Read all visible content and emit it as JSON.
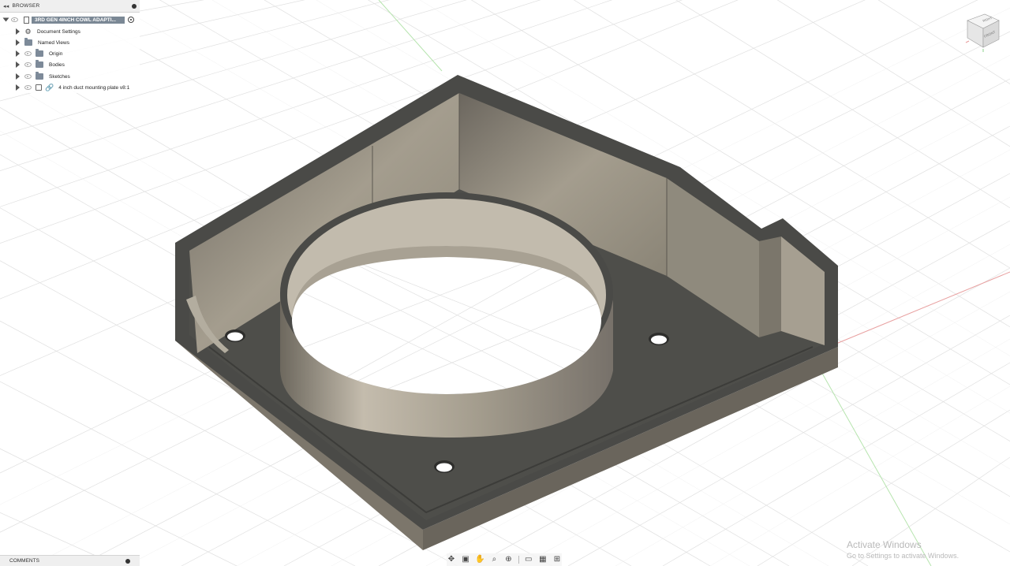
{
  "browser": {
    "title": "BROWSER",
    "root": "3RD GEN 4INCH COWL ADAPTI...",
    "items": [
      {
        "label": "Document Settings",
        "icon": "gear-icon"
      },
      {
        "label": "Named Views",
        "icon": "folder-icon"
      },
      {
        "label": "Origin",
        "icon": "folder-icon"
      },
      {
        "label": "Bodies",
        "icon": "folder-icon"
      },
      {
        "label": "Sketches",
        "icon": "folder-icon"
      },
      {
        "label": "4 inch duct mounting plate v8:1",
        "icon": "link-icon"
      }
    ]
  },
  "comments": {
    "title": "COMMENTS"
  },
  "viewcube": {
    "top": "FRONT",
    "right": "RIGHT"
  },
  "navbar": {
    "icons": [
      "orbit-icon",
      "look-at-icon",
      "pan-icon",
      "zoom-icon",
      "fit-icon",
      "display-settings-icon",
      "grid-icon",
      "viewports-icon"
    ]
  },
  "watermark": {
    "line1": "Activate Windows",
    "line2": "Go to Settings to activate Windows."
  },
  "colors": {
    "model_top": "#4a4a47",
    "model_floor": "#4f4f4b",
    "model_wall": "#908979",
    "grid": "#dcdcdc",
    "axis_red": "#e89b9b",
    "axis_green": "#a8e0a0",
    "browser_accent": "#7b8895"
  }
}
